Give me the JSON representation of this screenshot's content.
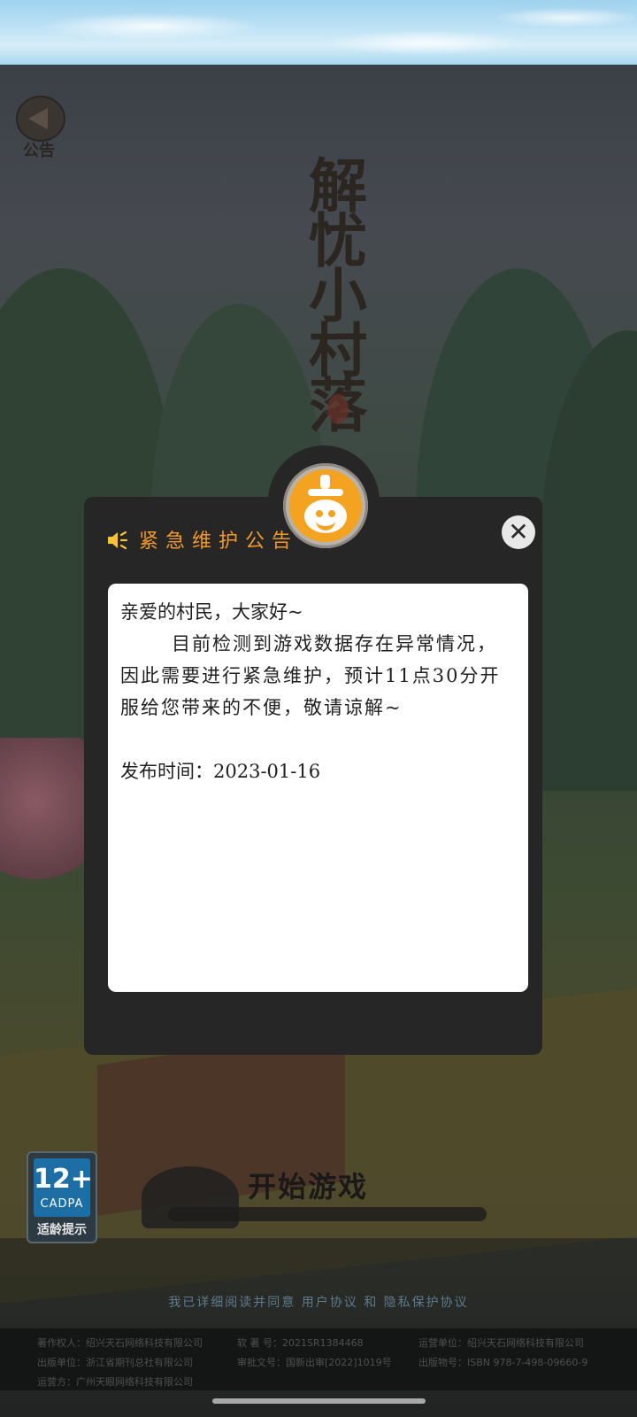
{
  "notice_button": {
    "label": "公告",
    "icon": "megaphone-icon"
  },
  "game_logo": {
    "title": "解忧小村落"
  },
  "dialog": {
    "title": "紧急维护公告",
    "speaker_icon": "speaker-icon",
    "close_icon": "close-icon",
    "close_glyph": "✕",
    "avatar_icon": "orange-mascot-icon",
    "accent_color": "#f19a2a",
    "body": {
      "greeting": "亲爱的村民，大家好~",
      "paragraph": "目前检测到游戏数据存在异常情况，因此需要进行紧急维护，预计11点30分开服给您带来的不便，敬请谅解~",
      "publish_time": "发布时间：2023-01-16"
    }
  },
  "start_button": {
    "label": "开始游戏"
  },
  "age_rating": {
    "number": "12+",
    "org": "CADPA",
    "hint": "适龄提示"
  },
  "agreement": {
    "prefix": "我已详细阅读并同意",
    "user_agreement": "用户协议",
    "conjunction": "和",
    "privacy_policy": "隐私保护协议"
  },
  "footer": {
    "copyright_holder": "著作权人：绍兴天石网络科技有限公司",
    "approval_no": "软  著  号：2021SR1384468",
    "operator": "运营单位：绍兴天石网络科技有限公司",
    "publisher": "出版单位：浙江省期刊总社有限公司",
    "license": "审批文号：国新出审[2022]1019号",
    "isbn": "出版物号：ISBN 978-7-498-09660-9",
    "supervisor": "运营方：广州天眼网络科技有限公司"
  }
}
